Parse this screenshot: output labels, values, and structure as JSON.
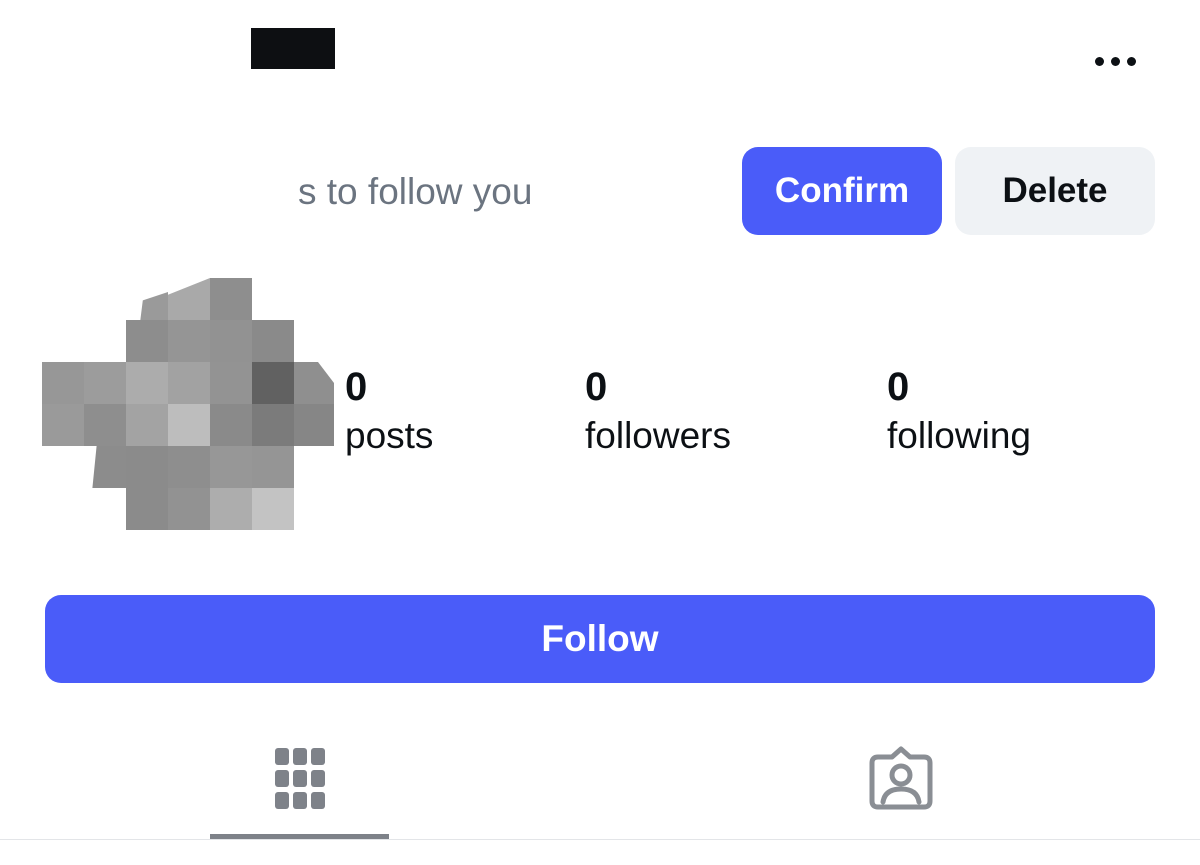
{
  "header": {
    "more_icon": "more-horizontal-icon"
  },
  "request": {
    "text": "s to follow you",
    "confirm_label": "Confirm",
    "delete_label": "Delete"
  },
  "stats": {
    "posts": {
      "count": "0",
      "label": "posts"
    },
    "followers": {
      "count": "0",
      "label": "followers"
    },
    "following": {
      "count": "0",
      "label": "following"
    }
  },
  "follow_label": "Follow",
  "tabs": [
    {
      "icon": "grid-icon",
      "selected": true
    },
    {
      "icon": "tagged-person-icon",
      "selected": false
    }
  ],
  "colors": {
    "accent": "#4a5cf9",
    "secondary_button": "#eff2f5",
    "muted_text": "#6b7480",
    "tab_icon": "#7e8289"
  }
}
